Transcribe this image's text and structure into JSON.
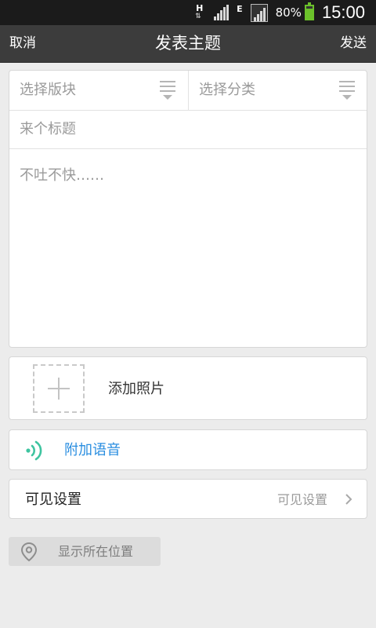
{
  "status_bar": {
    "network_type": "H",
    "network_arrows": "⇅",
    "secondary_network": "E",
    "battery_percent": "80%",
    "battery_level": 0.8,
    "time": "15:00"
  },
  "header": {
    "cancel_label": "取消",
    "title": "发表主题",
    "send_label": "发送"
  },
  "form": {
    "board_select": "选择版块",
    "category_select": "选择分类",
    "title_placeholder": "来个标题",
    "body_placeholder": "不吐不快……"
  },
  "attachments": {
    "add_photo_label": "添加照片",
    "add_voice_label": "附加语音"
  },
  "visibility": {
    "label": "可见设置",
    "value": "可见设置"
  },
  "location": {
    "label": "显示所在位置"
  },
  "colors": {
    "accent_blue": "#2a8ee0",
    "voice_green": "#3ec4a0",
    "battery_green": "#6bc12a"
  },
  "icons": {
    "menu": "menu-lines-icon",
    "plus": "plus-icon",
    "voice": "sound-waves-icon",
    "chevron": "chevron-right-icon",
    "location": "location-pin-icon"
  }
}
